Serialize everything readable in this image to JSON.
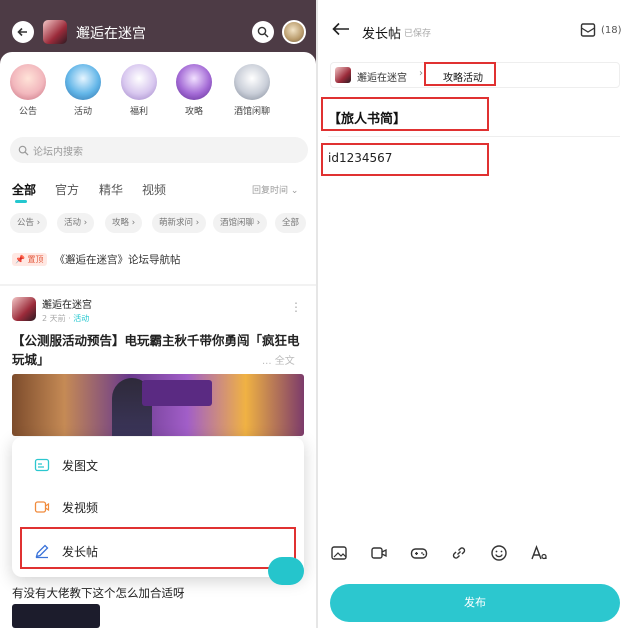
{
  "left": {
    "header": {
      "forum_name": "邂逅在迷宫"
    },
    "categories": [
      {
        "label": "公告",
        "color": "#f2b7bd"
      },
      {
        "label": "活动",
        "color": "#63b6e8"
      },
      {
        "label": "福利",
        "color": "#d8c7ef"
      },
      {
        "label": "攻略",
        "color": "#a46bd6"
      },
      {
        "label": "酒馆闲聊",
        "color": "#c9ced8"
      }
    ],
    "search": {
      "placeholder": "论坛内搜索"
    },
    "tabs": [
      "全部",
      "官方",
      "精华",
      "视频"
    ],
    "sort_label": "回复时间 ⌄",
    "chips": [
      "公告 ›",
      "活动 ›",
      "攻略 ›",
      "萌新求问 ›",
      "酒馆闲聊 ›",
      "全部"
    ],
    "pinned": {
      "tag": "📌 置顶",
      "text": "《邂逅在迷宫》论坛导航帖"
    },
    "post": {
      "author": "邂逅在迷宫",
      "time": "2 天前 · ",
      "tag": "活动",
      "title": "【公测服活动预告】电玩霸主秋千带你勇闯「疯狂电玩城」",
      "full": "... 全文"
    },
    "menu": [
      {
        "label": "发图文",
        "color": "#2cc7cf"
      },
      {
        "label": "发视频",
        "color": "#f08a3c"
      },
      {
        "label": "发长帖",
        "color": "#3b73d9"
      }
    ],
    "post2": {
      "title": "有没有大佬教下这个怎么加合适呀"
    }
  },
  "right": {
    "title": "发长帖",
    "saved": "已保存",
    "draft_count": "(18)",
    "forum_name": "邂逅在迷宫",
    "category": "攻略活动",
    "post_title": "【旅人书简】",
    "post_body": "id1234567",
    "publish_label": "发布",
    "toolbar_icons": [
      "image-icon",
      "video-icon",
      "gamepad-icon",
      "link-icon",
      "emoji-icon",
      "text-format-icon"
    ]
  },
  "accent": "#2cc7cf"
}
